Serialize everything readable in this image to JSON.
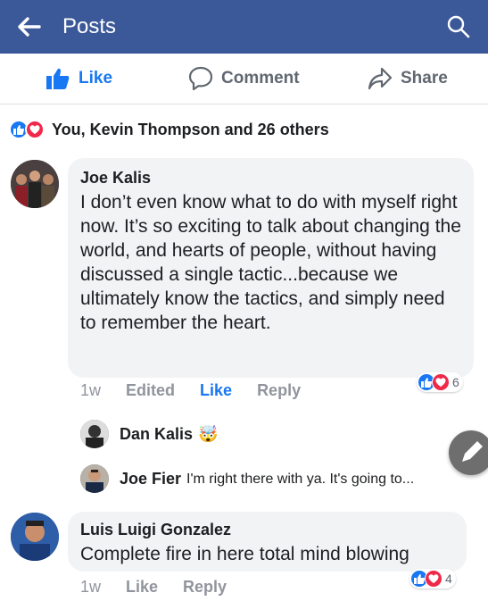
{
  "header": {
    "title": "Posts",
    "back_icon": "arrow-left-icon",
    "search_icon": "search-icon"
  },
  "post_actions": {
    "like": "Like",
    "comment": "Comment",
    "share": "Share"
  },
  "reactions_summary": {
    "text": "You, Kevin Thompson and 26 others"
  },
  "comments": [
    {
      "author": "Joe Kalis",
      "text": "I don’t even know what to do with myself right now. It’s so exciting to talk about changing the world, and hearts of people, without having discussed a single tactic...because we ultimately know the tactics, and simply need to remember the heart.",
      "time": "1w",
      "edited": "Edited",
      "like": "Like",
      "reply": "Reply",
      "reaction_count": "6",
      "replies": [
        {
          "author": "Dan Kalis",
          "text": "🤯"
        },
        {
          "author": "Joe Fier",
          "text": "I'm right there with ya. It's going to..."
        }
      ]
    },
    {
      "author": "Luis Luigi Gonzalez",
      "text": "Complete fire in here total mind blowing",
      "time": "1w",
      "like": "Like",
      "reply": "Reply",
      "reaction_count": "4"
    }
  ],
  "colors": {
    "brand": "#3b5998",
    "like_blue": "#1877f2",
    "love_red": "#f0284a"
  }
}
